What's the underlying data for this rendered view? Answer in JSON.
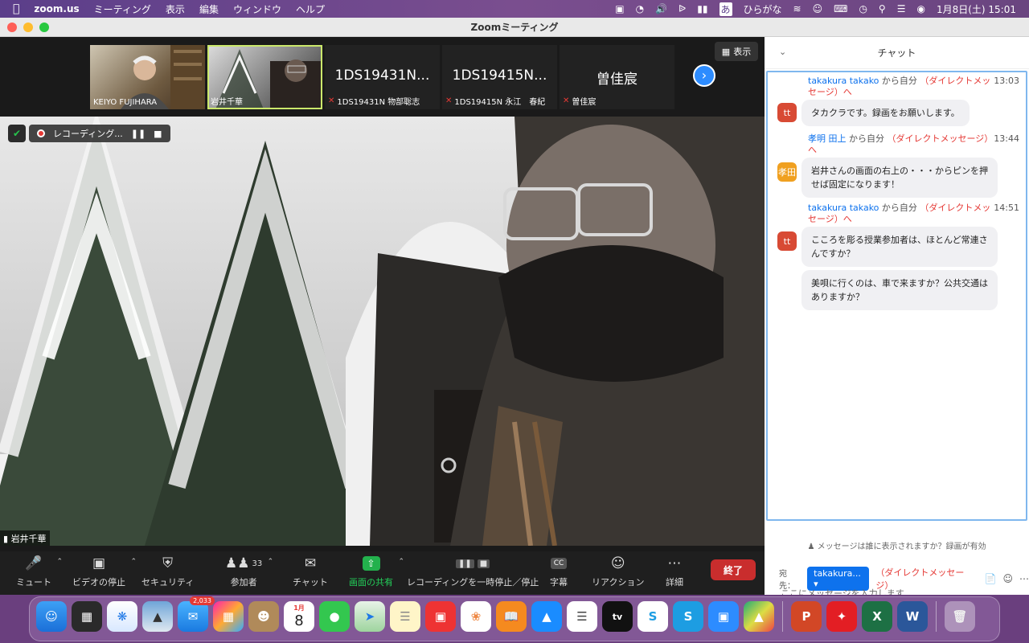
{
  "menubar": {
    "app": "zoom.us",
    "items": [
      "ミーティング",
      "表示",
      "編集",
      "ウィンドウ",
      "ヘルプ"
    ],
    "input_mode": "あ",
    "input_label": "ひらがな",
    "datetime": "1月8日(土)  15:01"
  },
  "window": {
    "title": "Zoomミーティング"
  },
  "strip": {
    "view_label": "表示",
    "tiles": [
      {
        "big": "",
        "name": "KEIYO FUJIHARA",
        "muted": false
      },
      {
        "big": "",
        "name": "岩井千華",
        "muted": false
      },
      {
        "big": "1DS19431N...",
        "name": "1DS19431N 物部聡志",
        "muted": true
      },
      {
        "big": "1DS19415N...",
        "name": "1DS19415N 永江　春紀",
        "muted": true
      },
      {
        "big": "曽佳宸",
        "name": "曽佳宸",
        "muted": true
      }
    ]
  },
  "recording": {
    "label": "レコーディング..."
  },
  "active_speaker": "岩井千華",
  "toolbar": {
    "mute": "ミュート",
    "video": "ビデオの停止",
    "security": "セキュリティ",
    "participants": "参加者",
    "participants_count": "33",
    "chat": "チャット",
    "share": "画面の共有",
    "recording": "レコーディングを一時停止／停止",
    "captions": "字幕",
    "captions_icon": "CC",
    "reactions": "リアクション",
    "more": "詳細",
    "end": "終了"
  },
  "chat": {
    "title": "チャット",
    "messages": [
      {
        "sender": "takakura takako",
        "from": " から自分 ",
        "dm": "（ダイレクトメッセージ）へ",
        "time": "13:03",
        "avatar": "tt",
        "avatar_color": "#d84a34",
        "texts": [
          "タカクラです。録画をお願いします。"
        ]
      },
      {
        "sender": "孝明 田上",
        "from": " から自分 ",
        "dm": "（ダイレクトメッセージ）へ",
        "time": "13:44",
        "avatar": "孝田",
        "avatar_color": "#f0a020",
        "texts": [
          "岩井さんの画面の右上の・・・からピンを押せば固定になります！"
        ]
      },
      {
        "sender": "takakura takako",
        "from": " から自分 ",
        "dm": "（ダイレクトメッセージ）へ",
        "time": "14:51",
        "avatar": "tt",
        "avatar_color": "#d84a34",
        "texts": [
          "こころを彫る授業参加者は、ほとんど常連さんですか？",
          "美唄に行くのは、車で来ますか？公共交通はありますか？"
        ]
      }
    ],
    "notice": "メッセージは誰に表示されますか？録画が有効",
    "to_label": "宛先：",
    "to_value": "takakura...",
    "to_dm": "（ダイレクトメッセージ）",
    "placeholder": "ここにメッセージを入力します..."
  },
  "dock": {
    "mail_badge": "2,033",
    "calendar_month": "1月",
    "calendar_day": "8",
    "tv_label": "tv"
  }
}
